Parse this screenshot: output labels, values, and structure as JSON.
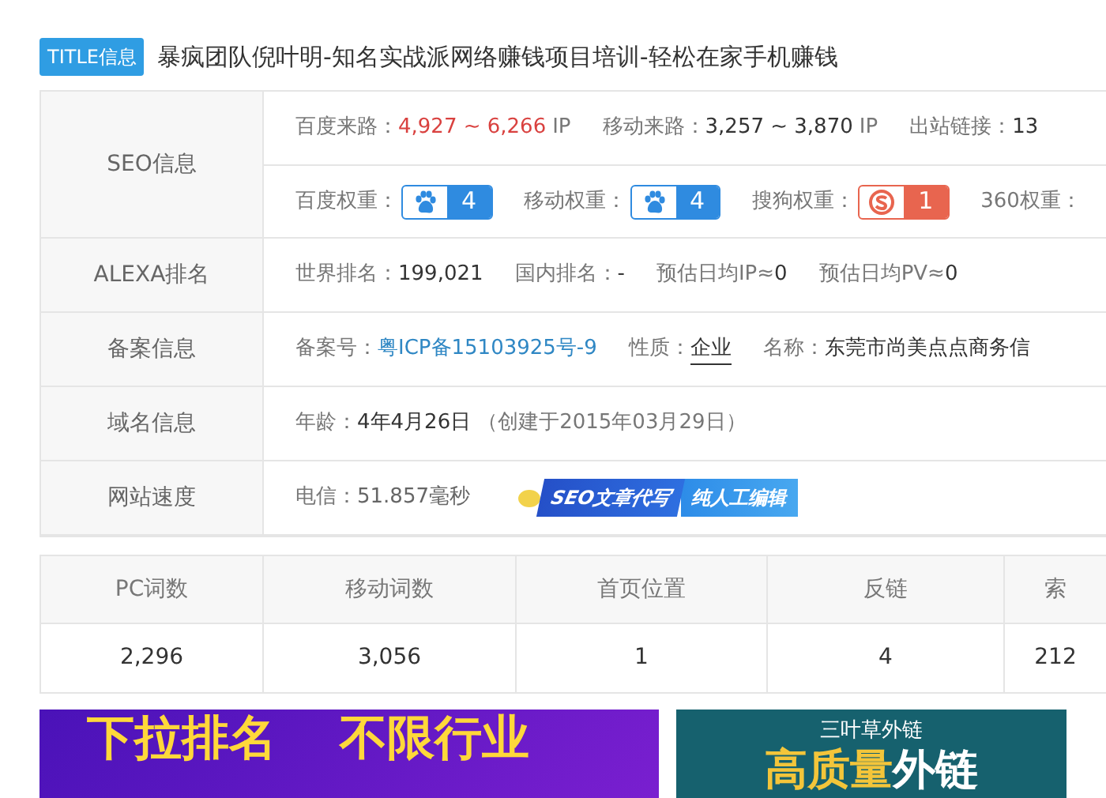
{
  "title": {
    "badge": "TITLE信息",
    "text": "暴疯团队倪叶明-知名实战派网络赚钱项目培训-轻松在家手机赚钱"
  },
  "info_rows": [
    {
      "label": "SEO信息",
      "lines": [
        [
          {
            "kind": "range",
            "label": "百度来路：",
            "value": "4,927 ~ 6,266",
            "unit": "IP"
          },
          {
            "kind": "range_plain",
            "label": "移动来路：",
            "value": "3,257 ~ 3,870",
            "unit": "IP"
          },
          {
            "kind": "plain",
            "label": "出站链接：",
            "value": "13"
          }
        ],
        [
          {
            "kind": "baidu_weight",
            "label": "百度权重：",
            "value": "4"
          },
          {
            "kind": "mobile_weight",
            "label": "移动权重：",
            "value": "4"
          },
          {
            "kind": "sogou_weight",
            "label": "搜狗权重：",
            "value": "1"
          },
          {
            "kind": "label_only",
            "label": "360权重："
          }
        ]
      ]
    },
    {
      "label": "ALEXA排名",
      "lines": [
        [
          {
            "kind": "plain",
            "label": "世界排名：",
            "value": "199,021"
          },
          {
            "kind": "plain",
            "label": "国内排名：",
            "value": "-"
          },
          {
            "kind": "plain",
            "label": "预估日均IP≈",
            "value": "0"
          },
          {
            "kind": "plain",
            "label": "预估日均PV≈",
            "value": "0"
          }
        ]
      ]
    },
    {
      "label": "备案信息",
      "lines": [
        [
          {
            "kind": "link",
            "label": "备案号：",
            "value": "粤ICP备15103925号-9"
          },
          {
            "kind": "underlined",
            "label": "性质：",
            "value": "企业"
          },
          {
            "kind": "plain",
            "label": "名称：",
            "value": "东莞市尚美点点商务信"
          }
        ]
      ]
    },
    {
      "label": "域名信息",
      "lines": [
        [
          {
            "kind": "plain",
            "label": "年龄：",
            "value": "4年4月26日",
            "note": "（创建于2015年03月29日）"
          }
        ]
      ]
    },
    {
      "label": "网站速度",
      "lines": [
        [
          {
            "kind": "plain_grey",
            "label": "电信：",
            "value": "51.857毫秒"
          },
          {
            "kind": "promo",
            "value": "SEO文章代写",
            "extra": "纯人工编辑"
          }
        ]
      ]
    }
  ],
  "stats": {
    "columns": [
      "PC词数",
      "移动词数",
      "首页位置",
      "反链",
      "索"
    ],
    "values": [
      "2,296",
      "3,056",
      "1",
      "4",
      "212"
    ]
  },
  "banners": [
    {
      "kind": "purple",
      "lines": [
        "下拉排名",
        "不限行业"
      ]
    },
    {
      "kind": "teal",
      "brand": "三叶草外链",
      "headline": "高质量",
      "headline_2": "外链"
    }
  ]
}
